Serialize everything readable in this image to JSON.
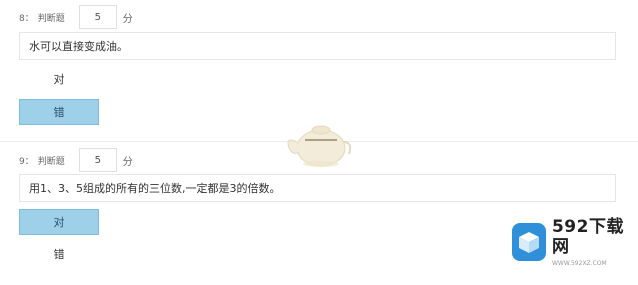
{
  "questions": [
    {
      "number": "8：",
      "type": "判断题",
      "score": "5",
      "score_unit": "分",
      "text": "水可以直接变成油。",
      "options": [
        {
          "label": "对",
          "selected": false
        },
        {
          "label": "错",
          "selected": true
        }
      ]
    },
    {
      "number": "9：",
      "type": "判断题",
      "score": "5",
      "score_unit": "分",
      "text": "用1、3、5组成的所有的三位数,一定都是3的倍数。",
      "options": [
        {
          "label": "对",
          "selected": true
        },
        {
          "label": "错",
          "selected": false
        }
      ]
    }
  ],
  "logo": {
    "name": "592下载网",
    "url_text": "WWW.592XZ.COM",
    "color": "#2f8fd8"
  },
  "colors": {
    "selected_option_bg": "#9fd0ea",
    "border": "#e6e6e6"
  }
}
